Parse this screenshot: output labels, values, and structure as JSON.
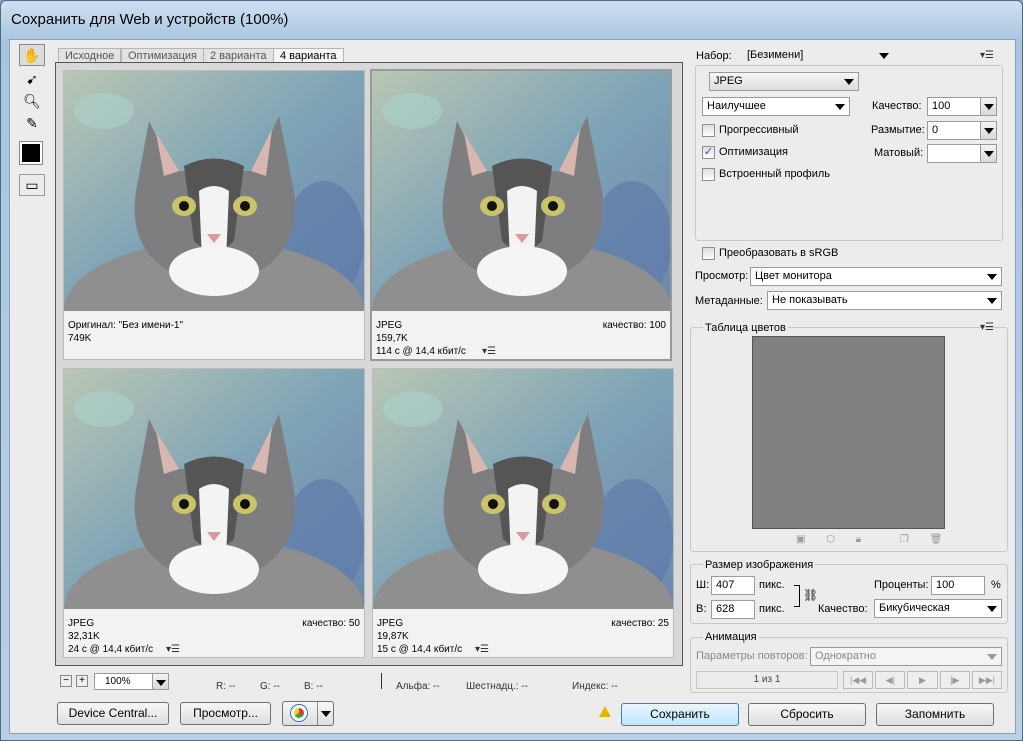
{
  "window": {
    "title": "Сохранить для Web и устройств (100%)"
  },
  "tabs": [
    "Исходное",
    "Оптимизация",
    "2 варианта",
    "4 варианта"
  ],
  "cells": [
    {
      "line1": "Оригинал: \"Без имени-1\"",
      "line2": "749K",
      "line3": "",
      "quality": ""
    },
    {
      "line1": "JPEG",
      "line2": "159,7K",
      "line3": "114 с @ 14,4 кбит/с",
      "quality": "качество: 100"
    },
    {
      "line1": "JPEG",
      "line2": "32,31K",
      "line3": "24 с @ 14,4 кбит/с",
      "quality": "качество: 50"
    },
    {
      "line1": "JPEG",
      "line2": "19,87K",
      "line3": "15 с @ 14,4 кбит/с",
      "quality": "качество: 25"
    }
  ],
  "zoom": {
    "value": "100%",
    "minus": "−",
    "plus": "+"
  },
  "readout": {
    "r": "R: --",
    "g": "G: --",
    "b": "B: --",
    "alpha": "Альфа: --",
    "hex": "Шестнадц.: --",
    "index": "Индекс: --"
  },
  "buttons": {
    "device": "Device Central...",
    "preview": "Просмотр...",
    "save": "Сохранить",
    "reset": "Сбросить",
    "remember": "Запомнить"
  },
  "settings": {
    "preset_label": "Набор:",
    "preset_value": "[Безимени]",
    "format": "JPEG",
    "quality_preset": "Наилучшее",
    "quality_label": "Качество:",
    "quality_value": "100",
    "blur_label": "Размытие:",
    "blur_value": "0",
    "matte_label": "Матовый:",
    "matte_value": "",
    "progressive": "Прогрессивный",
    "optimized": "Оптимизация",
    "embed_profile": "Встроенный профиль",
    "convert_srgb": "Преобразовать в sRGB",
    "preview_label": "Просмотр:",
    "preview_value": "Цвет монитора",
    "metadata_label": "Метаданные:",
    "metadata_value": "Не показывать"
  },
  "color_table": {
    "title": "Таблица цветов"
  },
  "image_size": {
    "title": "Размер изображения",
    "w_label": "Ш:",
    "w_value": "407",
    "h_label": "В:",
    "h_value": "628",
    "unit": "пикс.",
    "percent_label": "Проценты:",
    "percent_value": "100",
    "percent_sign": "%",
    "quality_label": "Качество:",
    "quality_value": "Бикубическая"
  },
  "animation": {
    "title": "Анимация",
    "loop_label": "Параметры повторов:",
    "loop_value": "Однократно",
    "frame": "1 из 1"
  },
  "colors": {
    "accent": "#3c7fb1",
    "table_bg": "#808080"
  }
}
